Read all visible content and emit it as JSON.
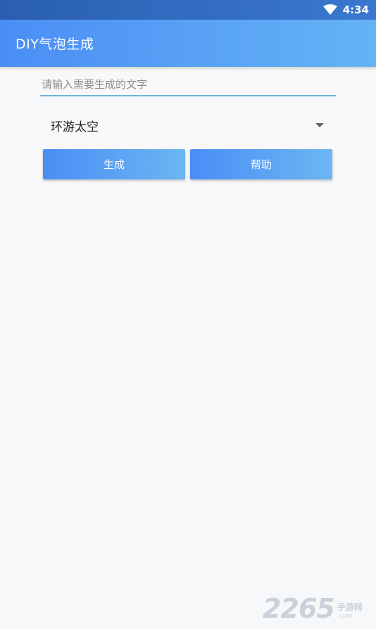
{
  "status_bar": {
    "time": "4:34",
    "wifi_icon": "wifi-icon"
  },
  "app_bar": {
    "title": "DIY气泡生成"
  },
  "text_input": {
    "value": "",
    "placeholder": "请输入需要生成的文字"
  },
  "style_select": {
    "selected": "环游太空",
    "arrow_icon": "dropdown-arrow-icon"
  },
  "buttons": {
    "generate_label": "生成",
    "help_label": "帮助"
  },
  "watermark": {
    "number": "2265",
    "text": "手游网",
    "url": ".com"
  },
  "colors": {
    "status_bar": "#2a5fb0",
    "app_bar_start": "#4a8ef5",
    "app_bar_end": "#65b3f5",
    "input_underline": "#6db5d8",
    "background": "#f7f8f9"
  }
}
